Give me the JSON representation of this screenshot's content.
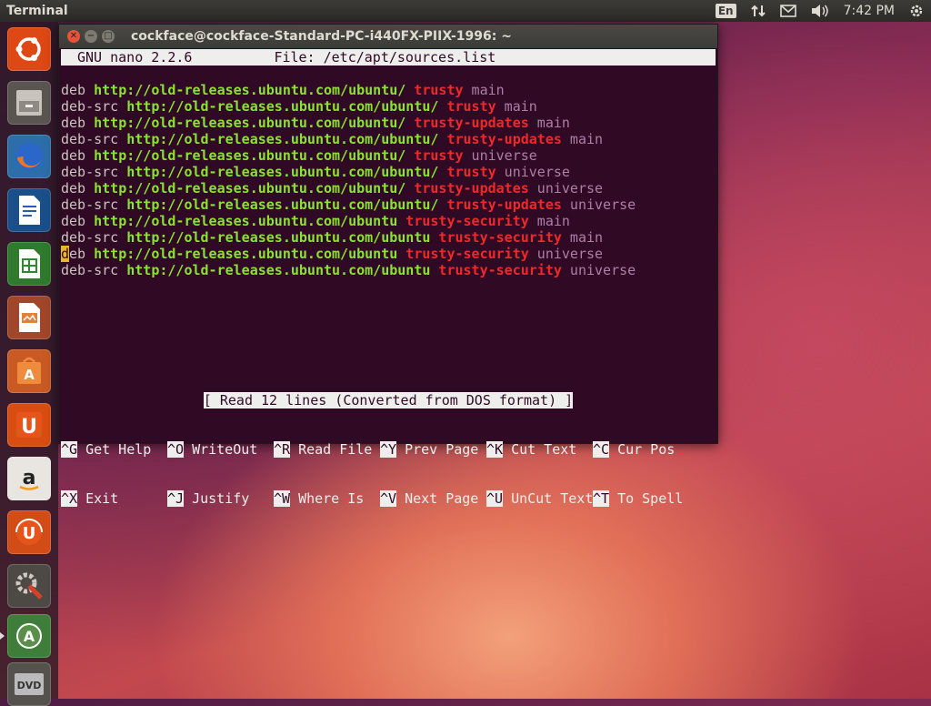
{
  "panel": {
    "app_title": "Terminal",
    "lang": "En",
    "clock": "7:42 PM"
  },
  "launcher": {
    "items": [
      "ubuntu-dash",
      "files",
      "firefox",
      "libreoffice-writer",
      "libreoffice-calc",
      "libreoffice-impress",
      "ubuntu-software-center",
      "ubuntu-one",
      "amazon",
      "ubuntu-one-music",
      "system-settings",
      "software-updater",
      "dvd"
    ]
  },
  "window": {
    "title": "cockface@cockface-Standard-PC-i440FX-PIIX-1996: ~"
  },
  "nano": {
    "version": "GNU nano 2.2.6",
    "file_label": "File: /etc/apt/sources.list",
    "lines": [
      {
        "type": "deb",
        "url": "http://old-releases.ubuntu.com/ubuntu/",
        "dist": "trusty",
        "comp": "main"
      },
      {
        "type": "deb-src",
        "url": "http://old-releases.ubuntu.com/ubuntu/",
        "dist": "trusty",
        "comp": "main"
      },
      {
        "type": "deb",
        "url": "http://old-releases.ubuntu.com/ubuntu/",
        "dist": "trusty-updates",
        "comp": "main"
      },
      {
        "type": "deb-src",
        "url": "http://old-releases.ubuntu.com/ubuntu/",
        "dist": "trusty-updates",
        "comp": "main"
      },
      {
        "type": "deb",
        "url": "http://old-releases.ubuntu.com/ubuntu/",
        "dist": "trusty",
        "comp": "universe"
      },
      {
        "type": "deb-src",
        "url": "http://old-releases.ubuntu.com/ubuntu/",
        "dist": "trusty",
        "comp": "universe"
      },
      {
        "type": "deb",
        "url": "http://old-releases.ubuntu.com/ubuntu/",
        "dist": "trusty-updates",
        "comp": "universe"
      },
      {
        "type": "deb-src",
        "url": "http://old-releases.ubuntu.com/ubuntu/",
        "dist": "trusty-updates",
        "comp": "universe"
      },
      {
        "type": "deb",
        "url": "http://old-releases.ubuntu.com/ubuntu",
        "dist": "trusty-security",
        "comp": "main"
      },
      {
        "type": "deb-src",
        "url": "http://old-releases.ubuntu.com/ubuntu",
        "dist": "trusty-security",
        "comp": "main"
      },
      {
        "type": "deb",
        "url": "http://old-releases.ubuntu.com/ubuntu",
        "dist": "trusty-security",
        "comp": "universe"
      },
      {
        "type": "deb-src",
        "url": "http://old-releases.ubuntu.com/ubuntu",
        "dist": "trusty-security",
        "comp": "universe"
      }
    ],
    "cursor_line": 10,
    "status_message": "[ Read 12 lines (Converted from DOS format) ]",
    "shortcuts_row1": [
      {
        "key": "^G",
        "label": "Get Help"
      },
      {
        "key": "^O",
        "label": "WriteOut"
      },
      {
        "key": "^R",
        "label": "Read File"
      },
      {
        "key": "^Y",
        "label": "Prev Page"
      },
      {
        "key": "^K",
        "label": "Cut Text"
      },
      {
        "key": "^C",
        "label": "Cur Pos"
      }
    ],
    "shortcuts_row2": [
      {
        "key": "^X",
        "label": "Exit"
      },
      {
        "key": "^J",
        "label": "Justify"
      },
      {
        "key": "^W",
        "label": "Where Is"
      },
      {
        "key": "^V",
        "label": "Next Page"
      },
      {
        "key": "^U",
        "label": "UnCut Text"
      },
      {
        "key": "^T",
        "label": "To Spell"
      }
    ]
  },
  "colors": {
    "terminal_bg": "#300a24",
    "url": "#8ae234",
    "dist": "#ef2929",
    "component": "#ad7fa8"
  }
}
